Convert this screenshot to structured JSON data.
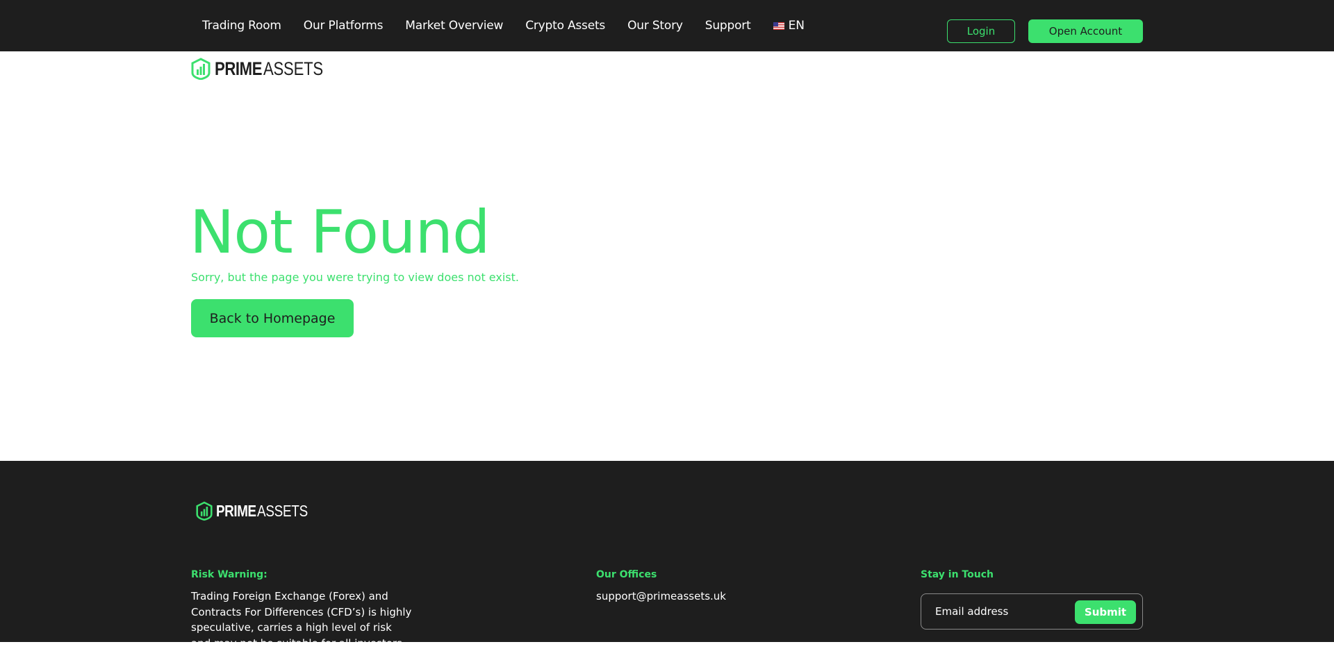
{
  "header": {
    "nav": [
      "Trading Room",
      "Our Platforms",
      "Market Overview",
      "Crypto Assets",
      "Our Story",
      "Support"
    ],
    "language": "EN",
    "flag_icon": "us-flag-icon",
    "login_label": "Login",
    "open_account_label": "Open Account"
  },
  "brand": {
    "logo_part1": "PRIME",
    "logo_part2": "ASSETS",
    "logo_icon": "bar-chart-shield-icon"
  },
  "main": {
    "title": "Not Found",
    "subtitle": "Sorry, but the page you were trying to view does not exist.",
    "back_label": "Back to Homepage"
  },
  "footer": {
    "risk_heading": "Risk Warning:",
    "risk_text": "Trading Foreign Exchange (Forex) and Contracts For Differences (CFD’s) is highly speculative, carries a high level of risk and may not be suitable for all investors. You",
    "offices_heading": "Our Offices",
    "offices_email": "support@primeassets.uk",
    "stay_heading": "Stay in Touch",
    "email_placeholder": "Email address",
    "submit_label": "Submit"
  },
  "colors": {
    "accent": "#3ce06e",
    "dark": "#1e1e1e",
    "white": "#ffffff"
  }
}
